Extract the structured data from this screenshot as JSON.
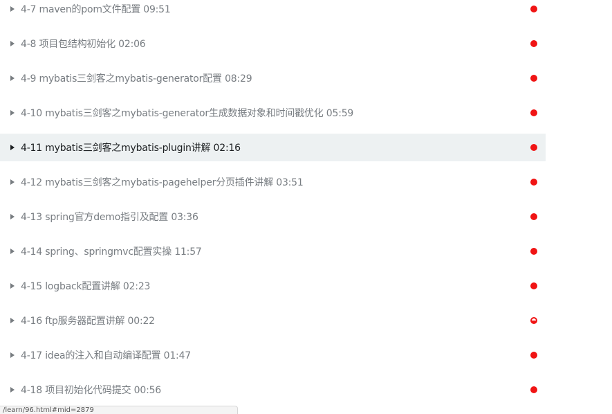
{
  "chapter_list": {
    "items": [
      {
        "label": "4-7 maven的pom文件配置 09:51",
        "active": false,
        "progress": "full"
      },
      {
        "label": "4-8 项目包结构初始化 02:06",
        "active": false,
        "progress": "full"
      },
      {
        "label": "4-9 mybatis三剑客之mybatis-generator配置 08:29",
        "active": false,
        "progress": "full"
      },
      {
        "label": "4-10 mybatis三剑客之mybatis-generator生成数据对象和时间戳优化 05:59",
        "active": false,
        "progress": "full"
      },
      {
        "label": "4-11 mybatis三剑客之mybatis-plugin讲解 02:16",
        "active": true,
        "progress": "full"
      },
      {
        "label": "4-12 mybatis三剑客之mybatis-pagehelper分页插件讲解 03:51",
        "active": false,
        "progress": "full"
      },
      {
        "label": "4-13 spring官方demo指引及配置 03:36",
        "active": false,
        "progress": "full"
      },
      {
        "label": "4-14 spring、springmvc配置实操 11:57",
        "active": false,
        "progress": "full"
      },
      {
        "label": "4-15 logback配置讲解 02:23",
        "active": false,
        "progress": "full"
      },
      {
        "label": "4-16 ftp服务器配置讲解 00:22",
        "active": false,
        "progress": "partial"
      },
      {
        "label": "4-17 idea的注入和自动编译配置 01:47",
        "active": false,
        "progress": "full"
      },
      {
        "label": "4-18 项目初始化代码提交 00:56",
        "active": false,
        "progress": "full"
      }
    ]
  },
  "colors": {
    "status_dot": "#f01414",
    "active_row_bg": "#edf1f2",
    "text": "#787d82",
    "active_text": "#1c1f21"
  },
  "icons": {
    "row_icon": "play-triangle-icon",
    "status_icon": "progress-dot-icon"
  },
  "status_bar": {
    "url_text": "/learn/96.html#mid=2879"
  }
}
